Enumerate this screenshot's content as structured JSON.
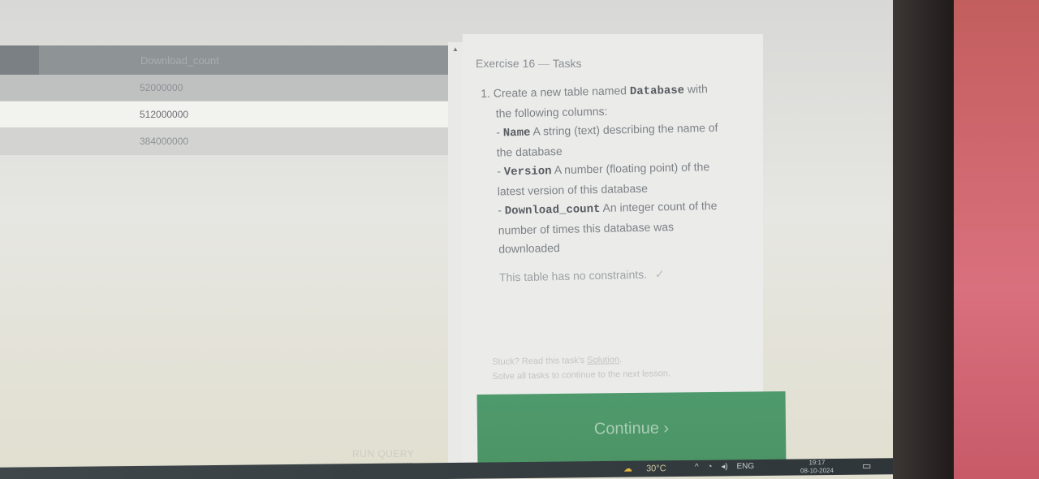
{
  "results": {
    "header": "Download_count",
    "rows": [
      "52000000",
      "512000000",
      "384000000"
    ]
  },
  "tasks": {
    "title": "Exercise 16",
    "title_sep": "—",
    "title_suffix": "Tasks",
    "intro_prefix": "1. Create a new table named",
    "table_name": "Database",
    "intro_suffix": "with",
    "intro_line2": "the following columns:",
    "columns": [
      {
        "dash": "-",
        "name": "Name",
        "desc_line1": "A string (text) describing the name of",
        "desc_line2": "the database"
      },
      {
        "dash": "-",
        "name": "Version",
        "desc_line1": "A number (floating point) of the",
        "desc_line2": "latest version of this database"
      },
      {
        "dash": "-",
        "name": "Download_count",
        "desc_line1": "An integer count of the",
        "desc_line2": "number of times this database was",
        "desc_line3": "downloaded"
      }
    ],
    "constraint_note": "This table has no constraints.",
    "check_mark": "✓",
    "hint_prefix": "Stuck? Read this task's",
    "hint_link": "Solution",
    "hint_suffix": ".",
    "hint_line2": "Solve all tasks to continue to the next lesson."
  },
  "continue_label": "Continue ›",
  "run_query_label": "RUN QUERY",
  "taskbar": {
    "temperature": "30°C",
    "weather_icon": "☁",
    "tray_caret": "^",
    "lang": "ENG",
    "time": "19:17",
    "date": "08-10-2024"
  },
  "colors": {
    "continue_green": "#4f9a6c",
    "header_gray": "#8e9396"
  }
}
